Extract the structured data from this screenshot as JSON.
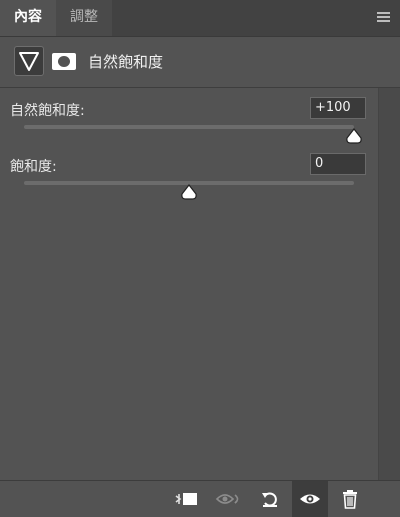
{
  "tabs": [
    {
      "label": "內容",
      "active": true
    },
    {
      "label": "調整",
      "active": false
    }
  ],
  "header": {
    "title": "自然飽和度",
    "adjustment_icon": "adjustment-triangle-icon",
    "mask_icon": "layer-mask-icon"
  },
  "sliders": [
    {
      "label": "自然飽和度:",
      "value": "+100",
      "numeric": 100,
      "min": -100,
      "max": 100
    },
    {
      "label": "飽和度:",
      "value": "0",
      "numeric": 0,
      "min": -100,
      "max": 100
    }
  ],
  "footer": {
    "icons": [
      "clip-to-layer-icon",
      "view-previous-state-icon",
      "reset-icon",
      "visibility-eye-icon",
      "trash-icon"
    ]
  },
  "colors": {
    "panel_bg": "#535353",
    "tab_bar_bg": "#424242",
    "track": "#6c6c6c",
    "thumb": "#ffffff"
  }
}
